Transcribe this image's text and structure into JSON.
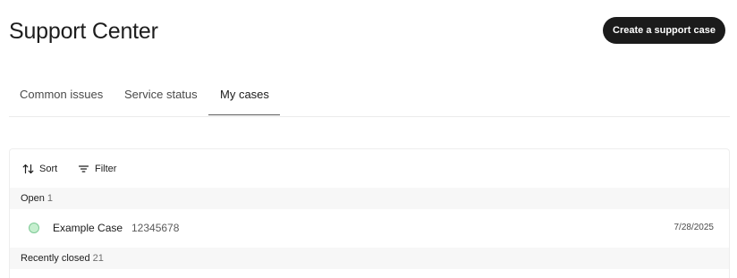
{
  "page": {
    "title": "Support Center",
    "create_button_label": "Create a support case"
  },
  "tabs": [
    {
      "label": "Common issues",
      "active": false
    },
    {
      "label": "Service status",
      "active": false
    },
    {
      "label": "My cases",
      "active": true
    }
  ],
  "toolbar": {
    "sort_label": "Sort",
    "sort_icon": "sort-arrows-icon",
    "filter_label": "Filter",
    "filter_icon": "filter-lines-icon"
  },
  "groups": {
    "open": {
      "label": "Open",
      "count": "1"
    },
    "closed": {
      "label": "Recently closed",
      "count": "21"
    }
  },
  "cases": [
    {
      "title": "Example Case",
      "case_id": "12345678",
      "date": "7/28/2025",
      "status": "open",
      "status_color": "#c6efcf"
    }
  ],
  "colors": {
    "primary_button": "#1b1b1b",
    "status_open": "#c6efcf",
    "group_header_bg": "#f7f7f7"
  }
}
